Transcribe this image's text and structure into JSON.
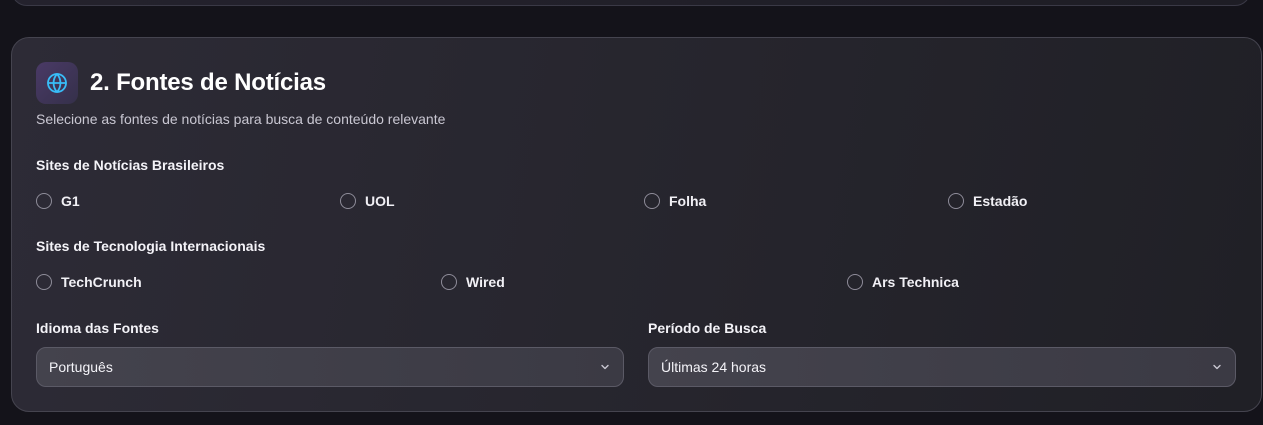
{
  "section": {
    "title": "2. Fontes de Notícias",
    "subtitle": "Selecione as fontes de notícias para busca de conteúdo relevante",
    "icon": "globe-icon",
    "accent": "#38bdf8"
  },
  "brazilian_sites": {
    "label": "Sites de Notícias Brasileiros",
    "options": [
      {
        "label": "G1",
        "checked": false
      },
      {
        "label": "UOL",
        "checked": false
      },
      {
        "label": "Folha",
        "checked": false
      },
      {
        "label": "Estadão",
        "checked": false
      }
    ]
  },
  "tech_sites": {
    "label": "Sites de Tecnologia Internacionais",
    "options": [
      {
        "label": "TechCrunch",
        "checked": false
      },
      {
        "label": "Wired",
        "checked": false
      },
      {
        "label": "Ars Technica",
        "checked": false
      }
    ]
  },
  "language": {
    "label": "Idioma das Fontes",
    "value": "Português"
  },
  "period": {
    "label": "Período de Busca",
    "value": "Últimas 24 horas"
  }
}
